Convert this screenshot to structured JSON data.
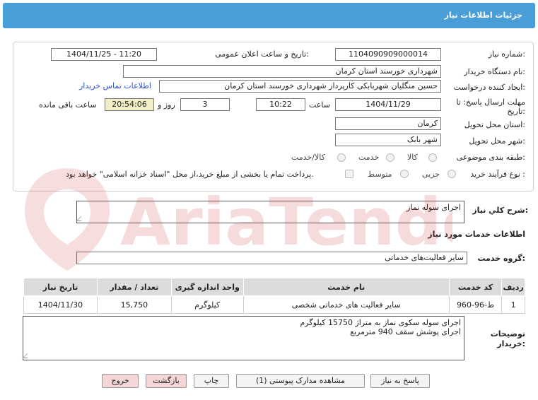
{
  "header": {
    "title": "جزئیات اطلاعات نیاز"
  },
  "form": {
    "need_number": {
      "label": "شماره نیاز:",
      "value": "1104090909000014"
    },
    "announce": {
      "label": "تاریخ و ساعت اعلان عمومی:",
      "value": "1404/11/25 - 11:20"
    },
    "buyer_org": {
      "label": "نام دستگاه خریدار:",
      "value": "شهرداری خورسند استان کرمان"
    },
    "creator": {
      "label": "ایجاد کننده درخواست:",
      "value": "حسین منگلیان شهربابکی کارپرداز شهرداری خورسند استان کرمان"
    },
    "contact_link": "اطلاعات تماس خریدار",
    "deadline": {
      "label_line1": "مهلت ارسال پاسخ: تا",
      "label_line2": "تاریخ:",
      "date": "1404/11/29",
      "time_label": "ساعت",
      "time": "10:22",
      "days": "3",
      "days_label": "روز و",
      "remaining": "20:54:06",
      "remaining_label": "ساعت باقی مانده"
    },
    "province": {
      "label": "استان محل تحویل:",
      "value": "کرمان"
    },
    "city": {
      "label": "شهر محل تحویل:",
      "value": "شهر بابک"
    },
    "category": {
      "label": "طبقه بندی موضوعی:",
      "options": [
        "کالا",
        "خدمت",
        "کالا/خدمت"
      ]
    },
    "purchase": {
      "label": "نوع فرآیند خرید :",
      "options": [
        "جزیی",
        "متوسط"
      ],
      "note": "پرداخت تمام یا بخشی از مبلغ خرید،از محل \"اسناد خزانه اسلامی\" خواهد بود."
    }
  },
  "summary": {
    "label": "شرح کلي نياز:",
    "value": "اجرای سوله نماز"
  },
  "services_section": {
    "title": "اطلاعات خدمات مورد نیاز"
  },
  "service_group": {
    "label": "گروه خدمت:",
    "value": "سایر فعالیت‌های خدماتی"
  },
  "table": {
    "headers": [
      "ردیف",
      "کد خدمت",
      "نام خدمت",
      "واحد اندازه گیری",
      "تعداد / مقدار",
      "تاریخ نیاز"
    ],
    "rows": [
      [
        "1",
        "ط-96-960",
        "سایر فعالیت های خدماتی شخصی",
        "کیلوگرم",
        "15,750",
        "1404/11/30"
      ]
    ]
  },
  "buyer_notes": {
    "label_line1": "توضیحات",
    "label_line2": "خریدار:",
    "lines": [
      "اجرای سوله سکوی نماز به متراژ 15750 کیلوگرم",
      "اجرای پوشش سقف 940 مترمربع"
    ]
  },
  "buttons": {
    "reply": "پاسخ به نیاز",
    "attachments": "مشاهده مدارک پیوستی (1)",
    "print": "چاپ",
    "back": "بازگشت",
    "exit": "خروج"
  },
  "watermark": {
    "text": "AriaTender.net"
  },
  "colors": {
    "header": "#4a9ed8",
    "link": "#2b52d6",
    "remaining_bg": "#f0efc8",
    "watermark": "#e8a0a0"
  }
}
